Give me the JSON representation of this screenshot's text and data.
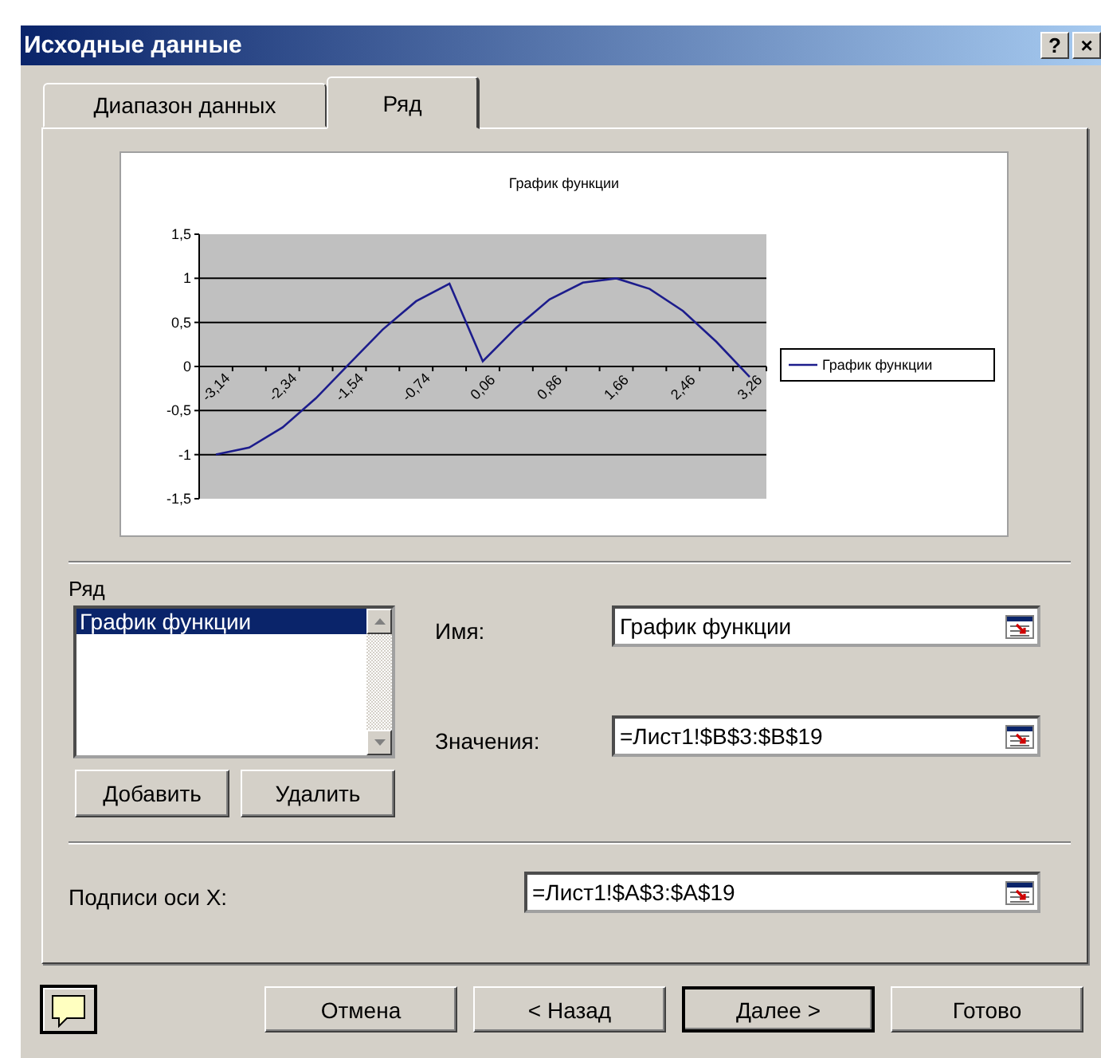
{
  "window": {
    "title": "Исходные данные",
    "title_buttons": [
      "?",
      "×"
    ]
  },
  "tabs": [
    {
      "label": "Диапазон данных",
      "selected": false
    },
    {
      "label": "Ряд",
      "selected": true
    }
  ],
  "chart": {
    "chart_data": {
      "type": "line",
      "title": "График функции",
      "grid": true,
      "x": [
        -3.14,
        -2.74,
        -2.34,
        -1.94,
        -1.54,
        -1.14,
        -0.74,
        -0.34,
        0.06,
        0.46,
        0.86,
        1.26,
        1.66,
        2.06,
        2.46,
        2.86,
        3.26
      ],
      "xlim": [
        -3.34,
        3.46
      ],
      "xticks": [
        {
          "value": -3.14,
          "label": "-3,14"
        },
        {
          "value": -2.34,
          "label": "-2,34"
        },
        {
          "value": -1.54,
          "label": "-1,54"
        },
        {
          "value": -0.74,
          "label": "-0,74"
        },
        {
          "value": 0.06,
          "label": "0,06"
        },
        {
          "value": 0.86,
          "label": "0,86"
        },
        {
          "value": 1.66,
          "label": "1,66"
        },
        {
          "value": 2.46,
          "label": "2,46"
        },
        {
          "value": 3.26,
          "label": "3,26"
        }
      ],
      "series": [
        {
          "name": "График функции",
          "color": "#1c1c8c",
          "values": [
            -1,
            -0.92,
            -0.69,
            -0.36,
            0.03,
            0.42,
            0.74,
            0.94,
            0.06,
            0.44,
            0.76,
            0.95,
            1,
            0.88,
            0.63,
            0.28,
            -0.12
          ]
        }
      ],
      "ylim": [
        -1.5,
        1.5
      ],
      "yticks": [
        {
          "value": 1.5,
          "label": "1,5"
        },
        {
          "value": 1,
          "label": "1"
        },
        {
          "value": 0.5,
          "label": "0,5"
        },
        {
          "value": 0,
          "label": "0"
        },
        {
          "value": -0.5,
          "label": "-0,5"
        },
        {
          "value": -1,
          "label": "-1"
        },
        {
          "value": -1.5,
          "label": "-1,5"
        }
      ]
    }
  },
  "series_list": {
    "label": "Ряд",
    "items": [
      {
        "label": "График функции",
        "selected": true
      }
    ]
  },
  "fields": [
    {
      "label": "Имя:",
      "value": "График функции"
    },
    {
      "label": "Значения:",
      "value": "=Лист1!$B$3:$B$19"
    }
  ],
  "series_buttons": [
    "Добавить",
    "Удалить"
  ],
  "x_labels_field": {
    "label": "Подписи оси X:",
    "value": "=Лист1!$A$3:$A$19"
  },
  "buttons": [
    {
      "label": "Отмена",
      "default": false
    },
    {
      "label": "< Назад",
      "default": false
    },
    {
      "label": "Далее >",
      "default": true
    },
    {
      "label": "Готово",
      "default": false
    }
  ]
}
